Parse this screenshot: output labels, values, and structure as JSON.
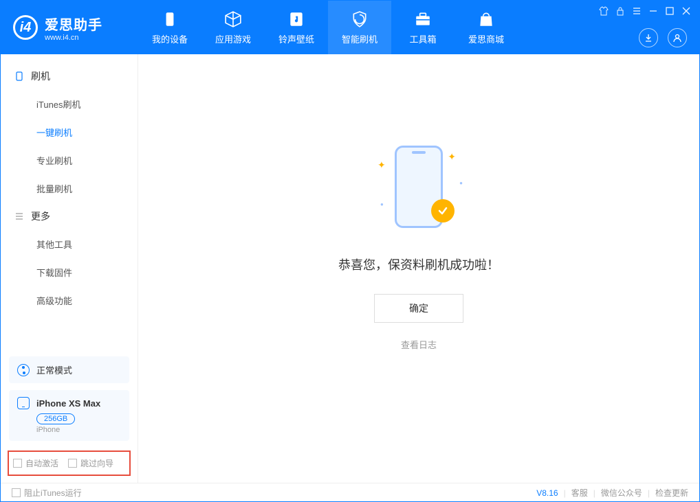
{
  "brand": {
    "title": "爱思助手",
    "sub": "www.i4.cn"
  },
  "nav": [
    {
      "label": "我的设备"
    },
    {
      "label": "应用游戏"
    },
    {
      "label": "铃声壁纸"
    },
    {
      "label": "智能刷机"
    },
    {
      "label": "工具箱"
    },
    {
      "label": "爱思商城"
    }
  ],
  "sidebar": {
    "group1": "刷机",
    "items1": [
      "iTunes刷机",
      "一键刷机",
      "专业刷机",
      "批量刷机"
    ],
    "group2": "更多",
    "items2": [
      "其他工具",
      "下载固件",
      "高级功能"
    ]
  },
  "mode": {
    "label": "正常模式"
  },
  "device": {
    "name": "iPhone XS Max",
    "storage": "256GB",
    "type": "iPhone"
  },
  "options": {
    "auto_activate": "自动激活",
    "skip_guide": "跳过向导"
  },
  "main": {
    "success": "恭喜您，保资料刷机成功啦！",
    "ok": "确定",
    "view_log": "查看日志"
  },
  "footer": {
    "block_itunes": "阻止iTunes运行",
    "version": "V8.16",
    "service": "客服",
    "wechat": "微信公众号",
    "update": "检查更新"
  }
}
